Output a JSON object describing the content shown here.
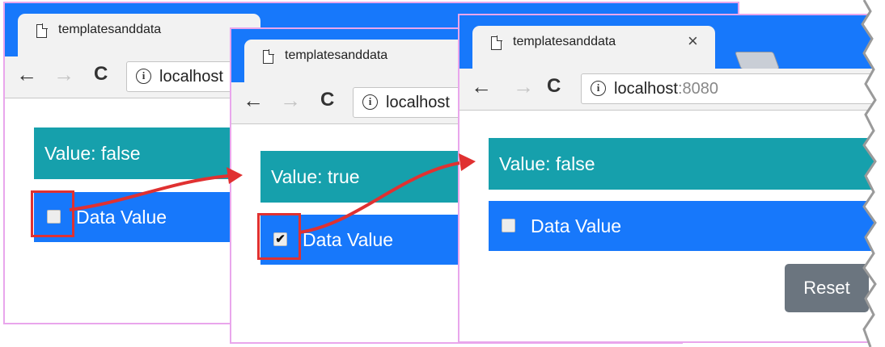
{
  "browsers": [
    {
      "tab_title": "templatesanddata",
      "url_host": "localhost",
      "url_port": "",
      "value_text": "Value: false",
      "data_label": "Data Value",
      "checkbox_checked": false
    },
    {
      "tab_title": "templatesanddata",
      "url_host": "localhost",
      "url_port": "",
      "value_text": "Value: true",
      "data_label": "Data Value",
      "checkbox_checked": true
    },
    {
      "tab_title": "templatesanddata",
      "url_host": "localhost",
      "url_port": ":8080",
      "value_text": "Value: false",
      "data_label": "Data Value",
      "checkbox_checked": false,
      "reset_label": "Reset"
    }
  ],
  "icons": {
    "back": "←",
    "forward": "→",
    "reload": "C",
    "info": "i",
    "close": "×",
    "check": "✔"
  },
  "colors": {
    "titlebar": "#1778fb",
    "value_bar": "#16a0ac",
    "data_bar": "#1778fb",
    "reset_button": "#6b757f",
    "annotation": "#e03131"
  }
}
